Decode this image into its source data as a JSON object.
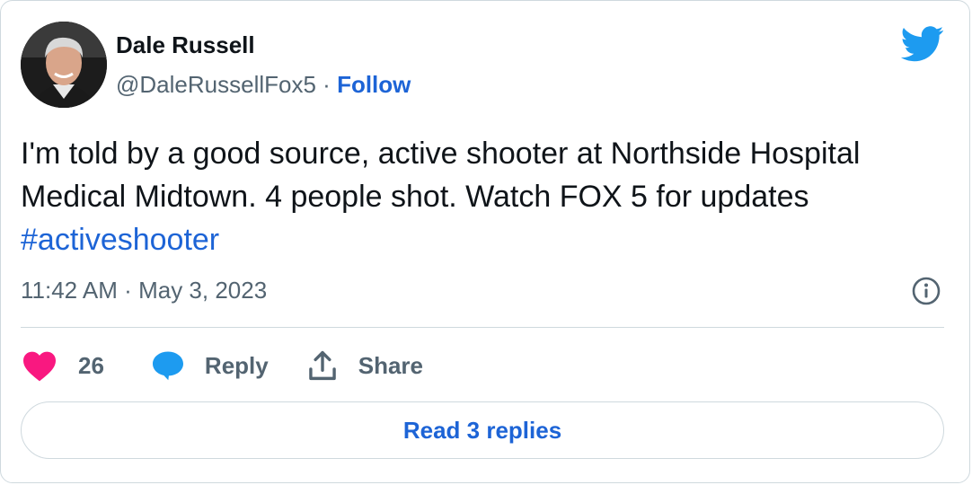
{
  "author": {
    "name": "Dale Russell",
    "handle": "@DaleRussellFox5",
    "separator": "·",
    "follow_label": "Follow"
  },
  "tweet": {
    "text": "I'm told by a good source, active shooter at Northside Hospital Medical Midtown. 4 people shot. Watch FOX 5 for updates ",
    "hashtag": "#activeshooter",
    "time": "11:42 AM",
    "separator": "·",
    "date": "May 3, 2023"
  },
  "actions": {
    "like_count": "26",
    "reply_label": "Reply",
    "share_label": "Share"
  },
  "read_replies_label": "Read 3 replies",
  "icons": {
    "logo": "twitter-bird-icon",
    "info": "info-icon",
    "like": "heart-icon",
    "reply": "speech-bubble-icon",
    "share": "share-upload-icon"
  },
  "colors": {
    "accent": "#1d64d6",
    "twitter_blue": "#1d9bf0",
    "like": "#f91880",
    "secondary_text": "#536471",
    "border": "#cfd9de"
  }
}
